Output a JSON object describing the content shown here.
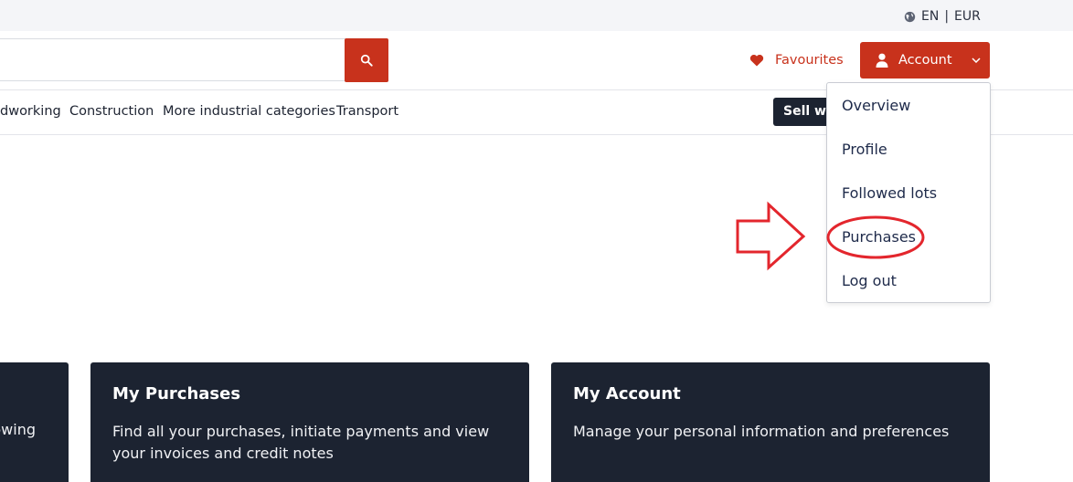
{
  "topbar": {
    "language": "EN",
    "separator": "|",
    "currency": "EUR",
    "globe_icon": "globe-icon"
  },
  "header": {
    "search": {
      "value": "",
      "placeholder": ""
    },
    "search_icon": "search-icon",
    "favourites_label": "Favourites",
    "account_label": "Account",
    "colors": {
      "accent": "#c8321c",
      "dark": "#1c2331"
    }
  },
  "categories": {
    "items": [
      "dworking",
      "Construction",
      "More industrial categories",
      "Transport"
    ],
    "sell_label": "Sell wit"
  },
  "account_menu": {
    "items": [
      "Overview",
      "Profile",
      "Followed lots",
      "Purchases",
      "Log out"
    ]
  },
  "cards": {
    "partial_text": "owing",
    "purchases": {
      "title": "My Purchases",
      "description": "Find all your purchases, initiate payments and view your invoices and credit notes"
    },
    "account": {
      "title": "My Account",
      "description": "Manage your personal information and preferences"
    }
  }
}
